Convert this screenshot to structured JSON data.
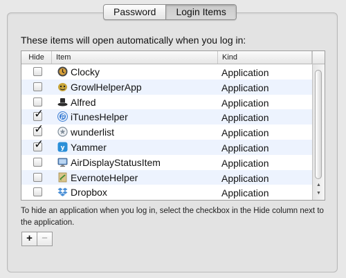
{
  "tabs": [
    {
      "label": "Password",
      "selected": false
    },
    {
      "label": "Login Items",
      "selected": true
    }
  ],
  "heading": "These items will open automatically when you log in:",
  "table": {
    "columns": {
      "hide": "Hide",
      "item": "Item",
      "kind": "Kind"
    },
    "rows": [
      {
        "name": "Clocky",
        "kind": "Application",
        "hide": false,
        "icon": "clock-icon",
        "icon_color": "#4a4a4a"
      },
      {
        "name": "GrowlHelperApp",
        "kind": "Application",
        "hide": false,
        "icon": "growl-icon",
        "icon_color": "#c8a53a"
      },
      {
        "name": "Alfred",
        "kind": "Application",
        "hide": false,
        "icon": "alfred-hat-icon",
        "icon_color": "#2c2c2c"
      },
      {
        "name": "iTunesHelper",
        "kind": "Application",
        "hide": true,
        "icon": "itunes-icon",
        "icon_color": "#3d7fd6"
      },
      {
        "name": "wunderlist",
        "kind": "Application",
        "hide": true,
        "icon": "wunderlist-icon",
        "icon_color": "#7f8c99"
      },
      {
        "name": "Yammer",
        "kind": "Application",
        "hide": true,
        "icon": "yammer-icon",
        "icon_color": "#2a8fd8"
      },
      {
        "name": "AirDisplayStatusItem",
        "kind": "Application",
        "hide": false,
        "icon": "display-icon",
        "icon_color": "#5b8fc9"
      },
      {
        "name": "EvernoteHelper",
        "kind": "Application",
        "hide": false,
        "icon": "evernote-icon",
        "icon_color": "#d9c48a"
      },
      {
        "name": "Dropbox",
        "kind": "Application",
        "hide": false,
        "icon": "dropbox-icon",
        "icon_color": "#4a8fd6"
      }
    ]
  },
  "hint": "To hide an application when you log in, select the checkbox in the Hide column next to the application.",
  "buttons": {
    "add": "+",
    "remove": "−"
  },
  "colors": {
    "row_alt": "#edf3fe",
    "accent_blue": "#3d7fd6"
  }
}
